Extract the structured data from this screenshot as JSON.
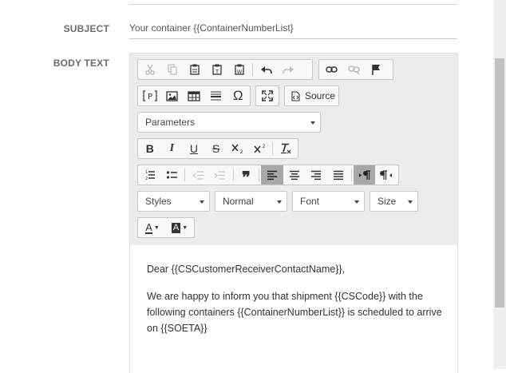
{
  "form": {
    "subject_label": "SUBJECT",
    "subject_value": "Your container {{ContainerNumberList}",
    "body_label": "BODY TEXT"
  },
  "toolbar": {
    "row1_icons": [
      "cut-icon",
      "copy-icon",
      "paste-icon",
      "paste-text-icon",
      "paste-word-icon",
      "undo-icon",
      "redo-icon",
      "link-icon",
      "unlink-icon",
      "anchor-flag-icon"
    ],
    "row2_icons": [
      "placeholder-icon",
      "image-icon",
      "table-icon",
      "horizontal-line-icon",
      "special-char-icon",
      "maximize-icon",
      "source-icon"
    ],
    "source_label": "Source",
    "parameters_label": "Parameters",
    "row4_icons": [
      "bold-icon",
      "italic-icon",
      "underline-icon",
      "strikethrough-icon",
      "subscript-icon",
      "superscript-icon",
      "remove-format-icon"
    ],
    "bold_glyph": "B",
    "italic_glyph": "I",
    "underline_glyph": "U",
    "strike_glyph": "S",
    "special_char_glyph": "Ω",
    "blockquote_glyph": "❞",
    "styles_label": "Styles",
    "format_label": "Normal",
    "font_label": "Font",
    "size_label": "Size",
    "text_color_glyph": "A",
    "bg_color_glyph": "A"
  },
  "content": {
    "greeting": "Dear {{CSCustomerReceiverContactName}},",
    "body": "We are happy to inform you that shipment {{CSCode}} with the following containers {{ContainerNumberList}} is scheduled to arrive on {{SOETA}}"
  }
}
